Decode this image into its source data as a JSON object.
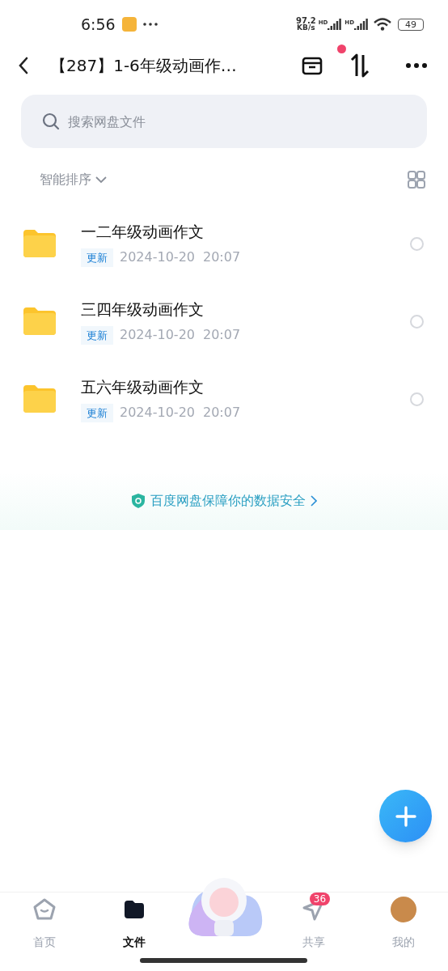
{
  "status_bar": {
    "time": "6:56",
    "net_speed": "97.2",
    "net_unit": "KB/s",
    "signal_labels": [
      "HD",
      "HD"
    ],
    "battery": "49"
  },
  "header": {
    "title": "【287】1-6年级动画作…"
  },
  "search": {
    "placeholder": "搜索网盘文件"
  },
  "sort": {
    "label": "智能排序"
  },
  "files": [
    {
      "name": "一二年级动画作文",
      "tag": "更新",
      "date": "2024-10-20",
      "time": "20:07",
      "selected": false
    },
    {
      "name": "三四年级动画作文",
      "tag": "更新",
      "date": "2024-10-20",
      "time": "20:07",
      "selected": false
    },
    {
      "name": "五六年级动画作文",
      "tag": "更新",
      "date": "2024-10-20",
      "time": "20:07",
      "selected": false
    }
  ],
  "banner": {
    "text": "百度网盘保障你的数据安全"
  },
  "nav": [
    {
      "kind": "home",
      "label": "首页",
      "selected": false
    },
    {
      "kind": "files",
      "label": "文件",
      "selected": true
    },
    {
      "kind": "mascot"
    },
    {
      "kind": "share",
      "label": "共享",
      "selected": false,
      "badge": "36"
    },
    {
      "kind": "avatar",
      "label": "我的",
      "selected": false
    }
  ]
}
